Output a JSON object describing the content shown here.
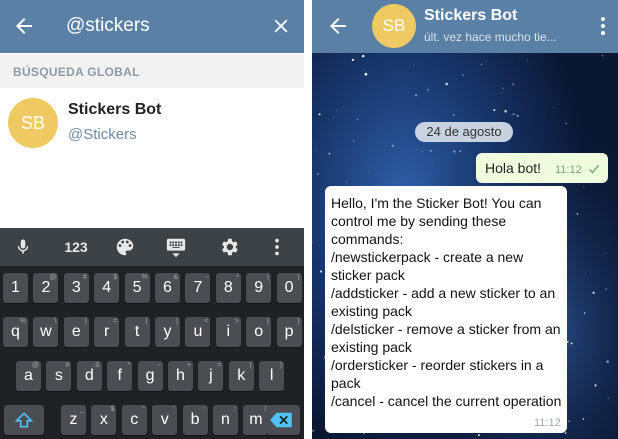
{
  "search_screen": {
    "query": "@stickers",
    "section_header": "BÚSQUEDA GLOBAL",
    "result": {
      "avatar_initials": "SB",
      "name": "Stickers Bot",
      "handle": "@Stickers"
    },
    "keyboard": {
      "toolbar": {
        "numbers_label": "123"
      },
      "rows": [
        [
          {
            "key": "1",
            "hint": ""
          },
          {
            "key": "2",
            "hint": "@"
          },
          {
            "key": "3",
            "hint": "#"
          },
          {
            "key": "4",
            "hint": "$"
          },
          {
            "key": "5",
            "hint": "%"
          },
          {
            "key": "6",
            "hint": "&"
          },
          {
            "key": "7",
            "hint": "-"
          },
          {
            "key": "8",
            "hint": "*"
          },
          {
            "key": "9",
            "hint": "("
          },
          {
            "key": "0",
            "hint": ")"
          }
        ],
        [
          {
            "key": "q",
            "hint": "%"
          },
          {
            "key": "w",
            "hint": "\\"
          },
          {
            "key": "e",
            "hint": "|"
          },
          {
            "key": "r",
            "hint": "="
          },
          {
            "key": "t",
            "hint": "["
          },
          {
            "key": "y",
            "hint": "]"
          },
          {
            "key": "u",
            "hint": "<"
          },
          {
            "key": "i",
            "hint": ">"
          },
          {
            "key": "o",
            "hint": "{"
          },
          {
            "key": "p",
            "hint": "}"
          }
        ],
        [
          {
            "key": "a",
            "hint": "@"
          },
          {
            "key": "s",
            "hint": "#"
          },
          {
            "key": "d",
            "hint": "&"
          },
          {
            "key": "f",
            "hint": "*"
          },
          {
            "key": "g",
            "hint": "-"
          },
          {
            "key": "h",
            "hint": "+"
          },
          {
            "key": "j",
            "hint": "="
          },
          {
            "key": "k",
            "hint": "("
          },
          {
            "key": "l",
            "hint": ")"
          }
        ],
        [
          {
            "key": "z",
            "hint": "_"
          },
          {
            "key": "x",
            "hint": "$"
          },
          {
            "key": "c",
            "hint": "\""
          },
          {
            "key": "v",
            "hint": "'"
          },
          {
            "key": "b",
            "hint": ":"
          },
          {
            "key": "n",
            "hint": ";"
          },
          {
            "key": "m",
            "hint": "/"
          }
        ]
      ]
    }
  },
  "chat_screen": {
    "avatar_initials": "SB",
    "title": "Stickers Bot",
    "status": "últ. vez hace mucho tie...",
    "date": "24 de agosto",
    "outgoing": {
      "text": "Hola bot!",
      "time": "11:12"
    },
    "incoming": {
      "text": "Hello, I'm the Sticker Bot! You can control me by sending these commands:\n/newstickerpack - create a new sticker pack\n/addsticker - add a new sticker to an existing pack\n/delsticker - remove a sticker from an existing pack\n/ordersticker - reorder stickers in a pack\n/cancel - cancel the current operation",
      "time": "11:12"
    }
  },
  "colors": {
    "header": "#5b80a5",
    "avatar": "#efca62",
    "outgoing_bubble": "#effdde",
    "section_header_bg": "#f2f2f2",
    "shift_accent": "#4fc3f7",
    "delete_accent": "#4fc3f7"
  }
}
